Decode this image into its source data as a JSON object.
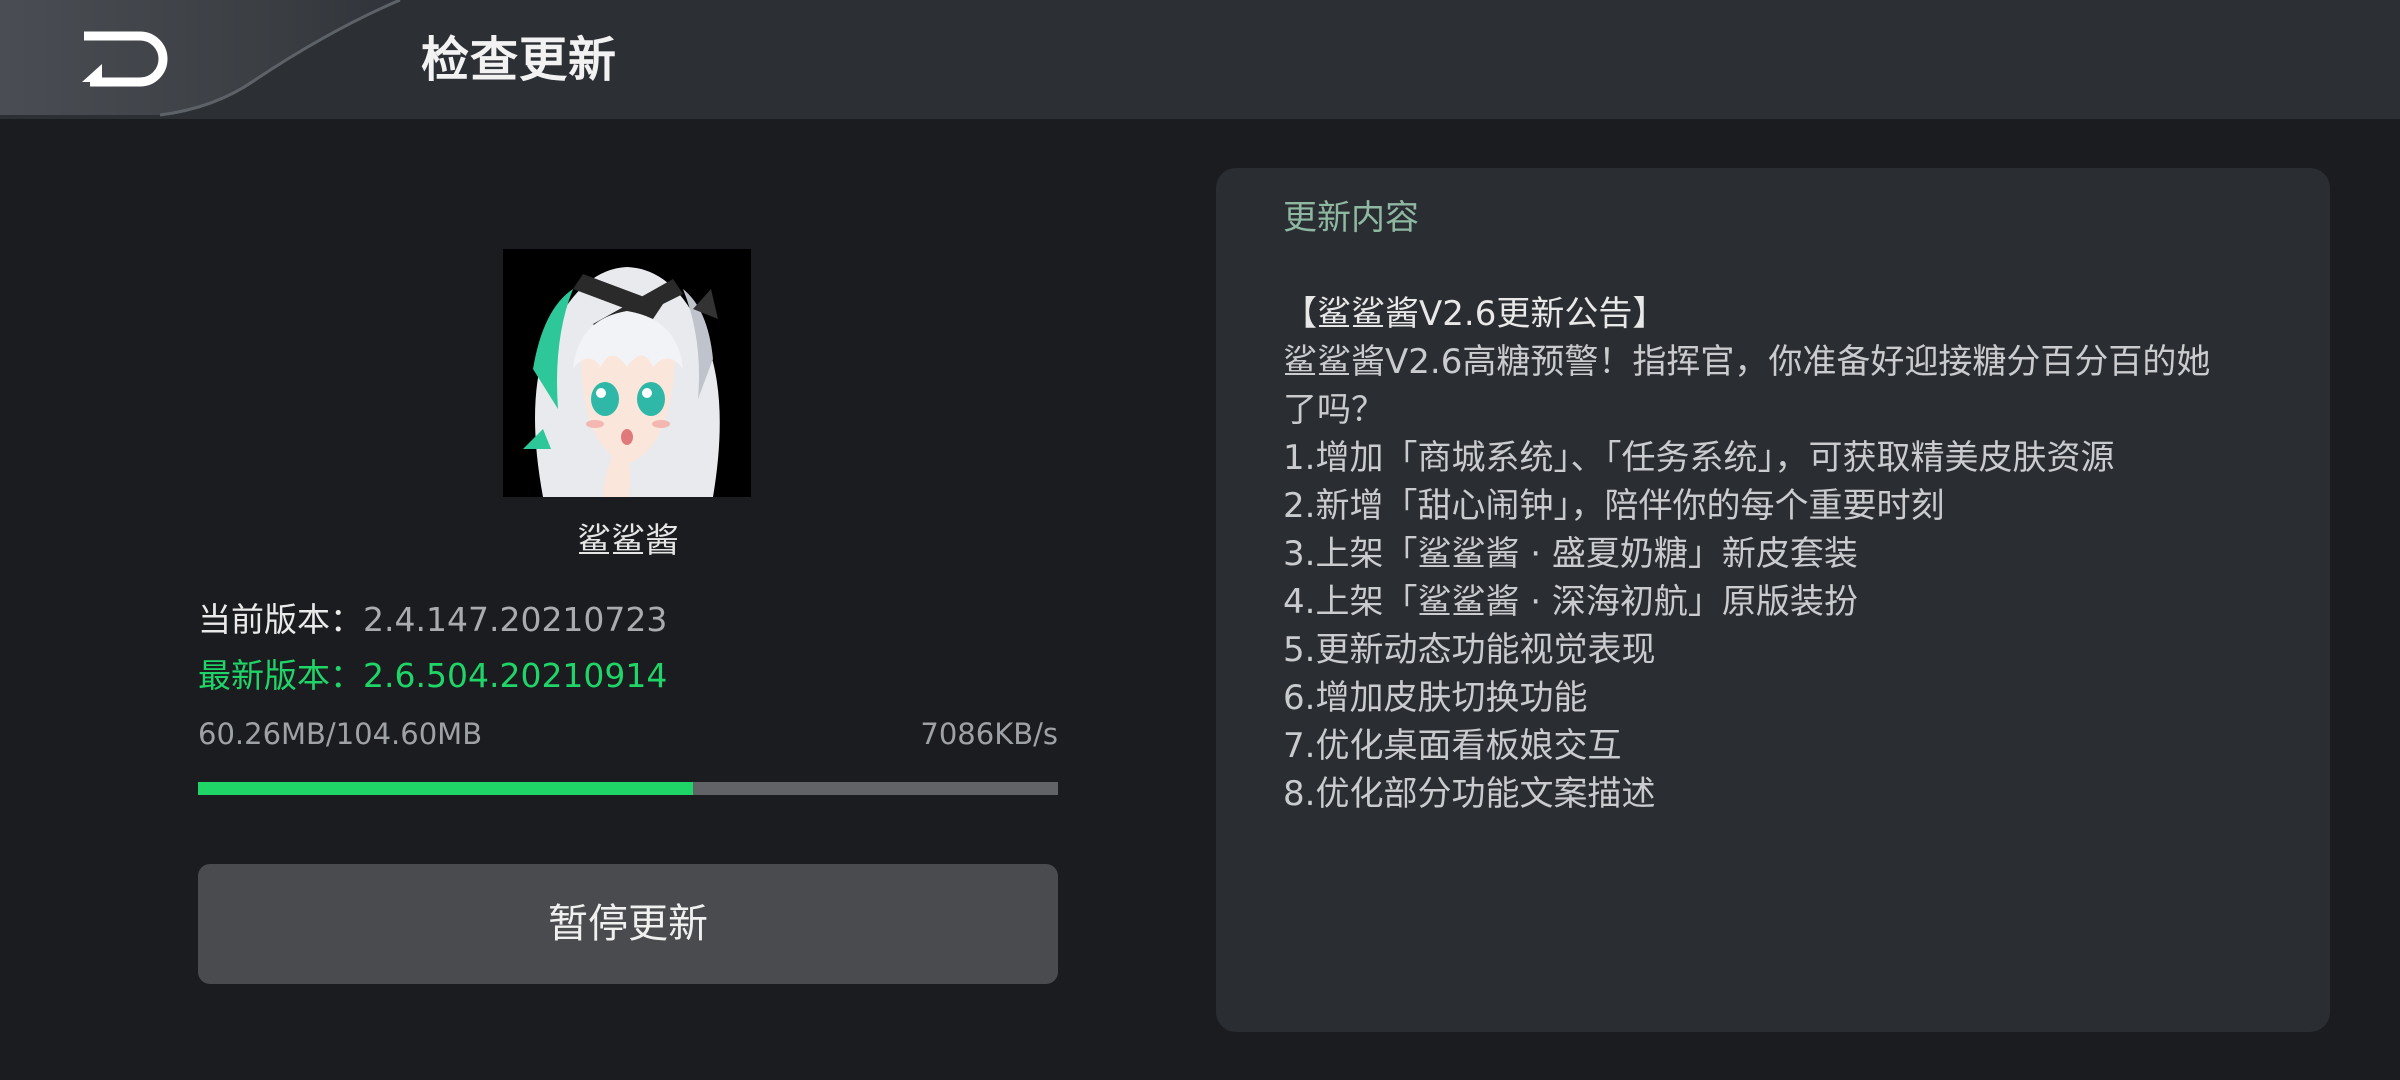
{
  "header": {
    "title": "检查更新",
    "back_icon": "back-arrow-icon"
  },
  "app": {
    "name": "鲨鲨酱",
    "avatar": "anime-character-avatar"
  },
  "version": {
    "current_label": "当前版本：",
    "current_value": "2.4.147.20210723",
    "latest_label": "最新版本：",
    "latest_value": "2.6.504.20210914"
  },
  "download": {
    "size_text": "60.26MB/104.60MB",
    "speed_text": "7086KB/s",
    "progress": 0.576
  },
  "actions": {
    "pause_label": "暂停更新"
  },
  "notes": {
    "heading": "更新内容",
    "lines": [
      "【鲨鲨酱V2.6更新公告】",
      "鲨鲨酱V2.6高糖预警！指挥官，你准备好迎接糖分百分百的她",
      "了吗？",
      "1.增加「商城系统」、「任务系统」，可获取精美皮肤资源",
      "2.新增「甜心闹钟」，陪伴你的每个重要时刻",
      "3.上架「鲨鲨酱 · 盛夏奶糖」新皮套装",
      "4.上架「鲨鲨酱 · 深海初航」原版装扮",
      "5.更新动态功能视觉表现",
      "6.增加皮肤切换功能",
      "7.优化桌面看板娘交互",
      "8.优化部分功能文案描述"
    ]
  },
  "colors": {
    "accent_green": "#1fd567",
    "heading_green": "#8fb8a2",
    "background": "#1b1c20",
    "panel": "#2a2d31",
    "header": "#2c3035"
  }
}
